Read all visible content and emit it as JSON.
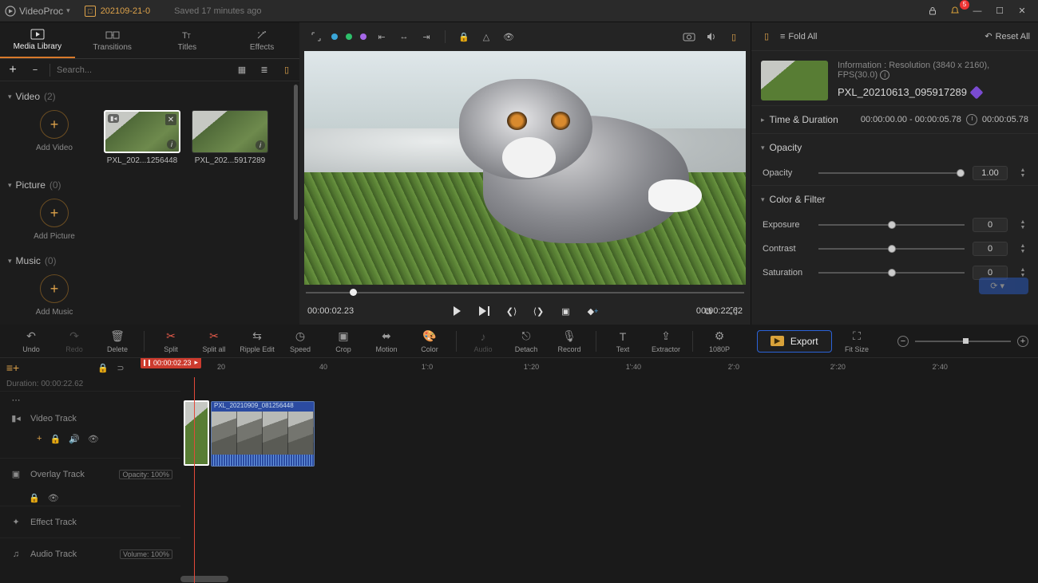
{
  "titlebar": {
    "app": "VideoProc",
    "project": "202109-21-0",
    "saved": "Saved 17 minutes ago",
    "notif_count": "5"
  },
  "tabs": {
    "media": "Media Library",
    "transitions": "Transitions",
    "titles": "Titles",
    "effects": "Effects"
  },
  "search": {
    "placeholder": "Search..."
  },
  "library": {
    "video": {
      "label": "Video",
      "count": "(2)",
      "add": "Add Video",
      "clip1": "PXL_202...1256448",
      "clip2": "PXL_202...5917289"
    },
    "picture": {
      "label": "Picture",
      "count": "(0)",
      "add": "Add Picture"
    },
    "music": {
      "label": "Music",
      "count": "(0)",
      "add": "Add Music"
    }
  },
  "preview": {
    "pos": "00:00:02.23",
    "dur": "00:00:22.62"
  },
  "right": {
    "fold": "Fold All",
    "reset": "Reset All",
    "info_line": "Information : Resolution (3840 x 2160), FPS(30.0)",
    "clip_name": "PXL_20210613_095917289",
    "time_label": "Time & Duration",
    "time_range": "00:00:00.00 - 00:00:05.78",
    "time_len": "00:00:05.78",
    "opacity_label": "Opacity",
    "opacity_sub": "Opacity",
    "opacity_val": "1.00",
    "color_label": "Color & Filter",
    "exposure": "Exposure",
    "exposure_val": "0",
    "contrast": "Contrast",
    "contrast_val": "0",
    "saturation": "Saturation",
    "saturation_val": "0"
  },
  "edittools": {
    "undo": "Undo",
    "redo": "Redo",
    "delete": "Delete",
    "split": "Split",
    "splitall": "Split all",
    "ripple": "Ripple Edit",
    "speed": "Speed",
    "crop": "Crop",
    "motion": "Motion",
    "color": "Color",
    "audio": "Audio",
    "detach": "Detach",
    "record": "Record",
    "text": "Text",
    "extractor": "Extractor",
    "res": "1080P",
    "export": "Export",
    "fitsize": "Fit Size"
  },
  "timeline": {
    "playhead": "00:00:02.23",
    "duration_label": "Duration:",
    "duration": "00:00:22.62",
    "ticks": [
      "20",
      "40",
      "1':0",
      "1':20",
      "1':40",
      "2':0",
      "2':20",
      "2':40"
    ],
    "video_track": "Video Track",
    "overlay_track": "Overlay Track",
    "effect_track": "Effect Track",
    "audio_track": "Audio Track",
    "opacity_tag": "Opacity: 100%",
    "volume_tag": "Volume: 100%",
    "clip_tag": "PXL_20210909_081256448"
  }
}
